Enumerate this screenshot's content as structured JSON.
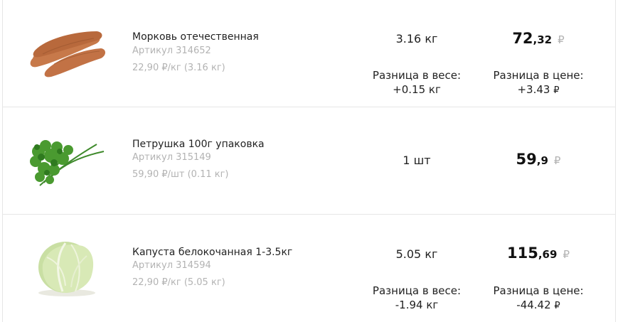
{
  "items": [
    {
      "name": "Морковь отечественная",
      "sku": "Артикул 314652",
      "unit_price": "22,90 ₽/кг (3.16 кг)",
      "quantity": "3.16 кг",
      "total_int": "72",
      "total_dec": ",32",
      "currency": "₽",
      "weight_diff_label": "Разница в весе:",
      "weight_diff_value": "+0.15 кг",
      "price_diff_label": "Разница в цене:",
      "price_diff_value": "+3.43",
      "price_diff_currency": "₽",
      "image_icon": "carrot-icon"
    },
    {
      "name": "Петрушка 100г упаковка",
      "sku": "Артикул 315149",
      "unit_price": "59,90 ₽/шт (0.11 кг)",
      "quantity": "1 шт",
      "total_int": "59",
      "total_dec": ",9",
      "currency": "₽",
      "image_icon": "parsley-icon"
    },
    {
      "name": "Капуста белокочанная 1-3.5кг",
      "sku": "Артикул 314594",
      "unit_price": "22,90 ₽/кг (5.05 кг)",
      "quantity": "5.05 кг",
      "total_int": "115",
      "total_dec": ",69",
      "currency": "₽",
      "weight_diff_label": "Разница в весе:",
      "weight_diff_value": "-1.94 кг",
      "price_diff_label": "Разница в цене:",
      "price_diff_value": "-44.42",
      "price_diff_currency": "₽",
      "image_icon": "cabbage-icon"
    }
  ]
}
